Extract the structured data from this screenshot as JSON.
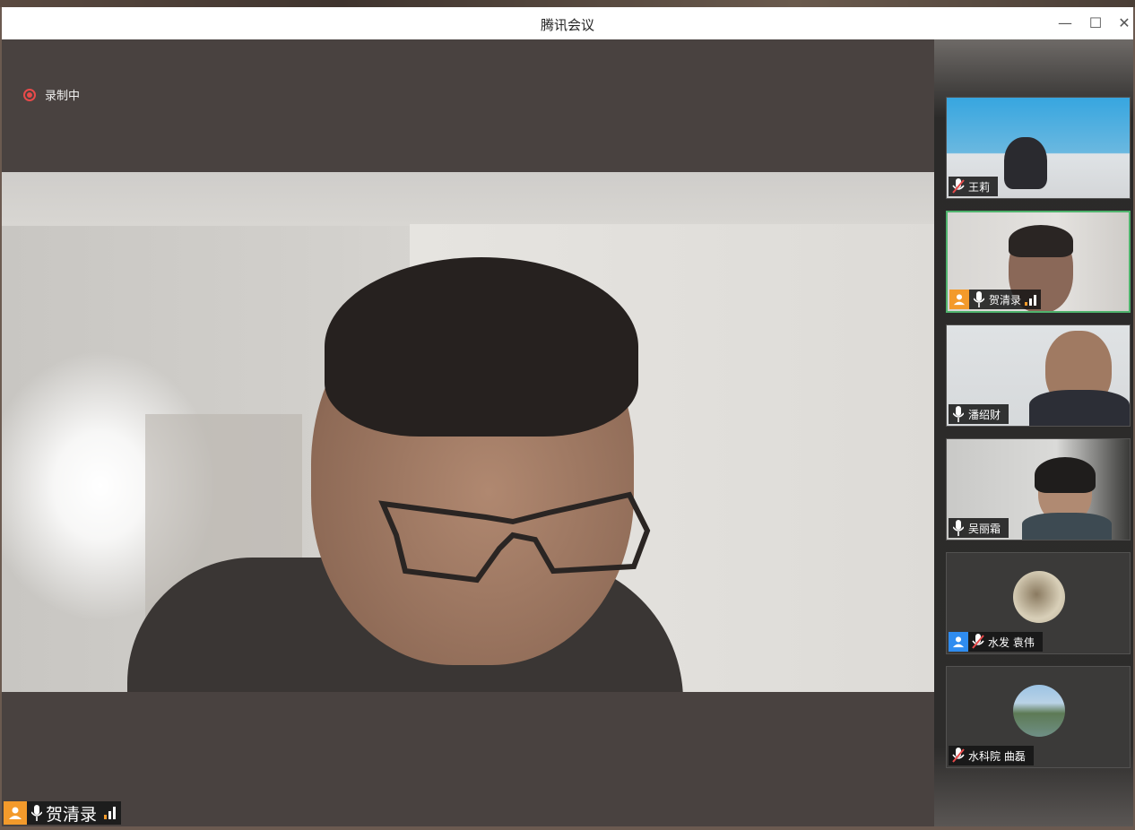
{
  "window": {
    "title": "腾讯会议"
  },
  "recording": {
    "label": "录制中"
  },
  "main_video": {
    "speaker_name": "贺清录"
  },
  "participants": [
    {
      "name": "王莉",
      "mic": "muted",
      "active": false
    },
    {
      "name": "贺清录",
      "mic": "on",
      "active": true,
      "host": true
    },
    {
      "name": "潘绍财",
      "mic": "on",
      "active": false
    },
    {
      "name": "吴丽霜",
      "mic": "on",
      "active": false
    },
    {
      "name": "水发 袁伟",
      "mic": "muted",
      "active": false,
      "video": "off"
    },
    {
      "name": "水科院 曲磊",
      "mic": "muted",
      "active": false,
      "video": "off"
    }
  ],
  "colors": {
    "recording": "#e84a4a",
    "active_border": "#4fb36d",
    "host_badge": "#f39a2b",
    "cohost_badge": "#2f8cf0"
  }
}
